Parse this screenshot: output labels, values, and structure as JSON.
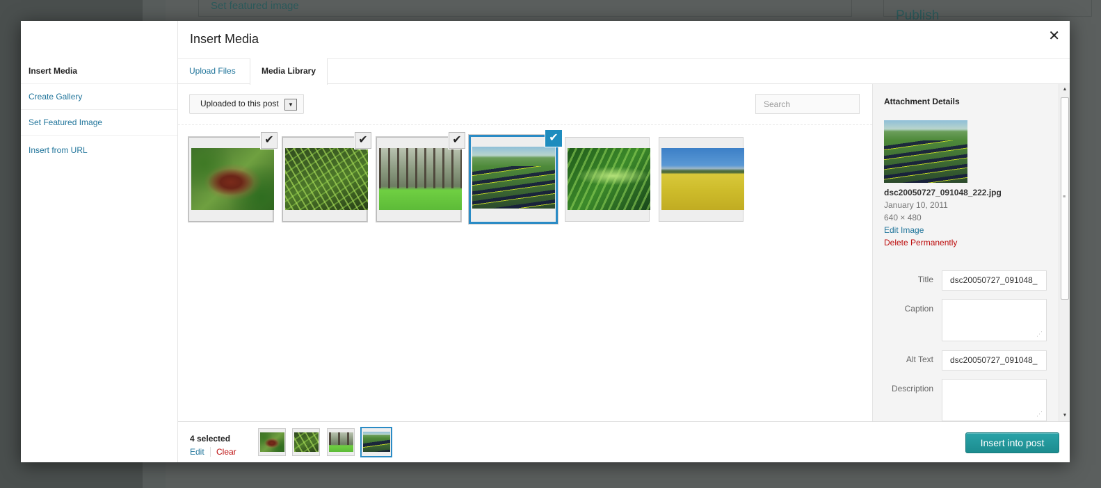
{
  "background": {
    "featured_link": "Set featured image",
    "publish_heading": "Publish"
  },
  "modal": {
    "title": "Insert Media",
    "close_icon": "close-icon",
    "menu": [
      {
        "label": "Insert Media",
        "active": true
      },
      {
        "label": "Create Gallery",
        "active": false
      },
      {
        "label": "Set Featured Image",
        "active": false
      },
      {
        "label": "Insert from URL",
        "active": false
      }
    ],
    "tabs": [
      {
        "label": "Upload Files",
        "active": false
      },
      {
        "label": "Media Library",
        "active": true
      }
    ]
  },
  "library": {
    "filter_selected": "Uploaded to this post",
    "search_placeholder": "Search",
    "items": [
      {
        "subject": "pine cone",
        "selected": true,
        "focused": false
      },
      {
        "subject": "pine needles",
        "selected": true,
        "focused": false
      },
      {
        "subject": "pine forest",
        "selected": true,
        "focused": false
      },
      {
        "subject": "planted field rows",
        "selected": true,
        "focused": true
      },
      {
        "subject": "fern frond",
        "selected": false,
        "focused": false
      },
      {
        "subject": "yellow field",
        "selected": false,
        "focused": false
      }
    ]
  },
  "attachment": {
    "heading": "Attachment Details",
    "filename": "dsc20050727_091048_222.jpg",
    "date": "January 10, 2011",
    "dimensions": "640 × 480",
    "edit_link": "Edit Image",
    "delete_link": "Delete Permanently",
    "fields": {
      "title_label": "Title",
      "title_value": "dsc20050727_091048_",
      "caption_label": "Caption",
      "caption_value": "",
      "alt_label": "Alt Text",
      "alt_value": "dsc20050727_091048_",
      "description_label": "Description",
      "description_value": ""
    }
  },
  "toolbar": {
    "selected_count": "4 selected",
    "edit_label": "Edit",
    "clear_label": "Clear",
    "insert_label": "Insert into post"
  },
  "colors": {
    "link": "#21759b",
    "danger": "#bc0b0b",
    "focus": "#2a8bc5",
    "primary_button": "#1c8c8f"
  }
}
